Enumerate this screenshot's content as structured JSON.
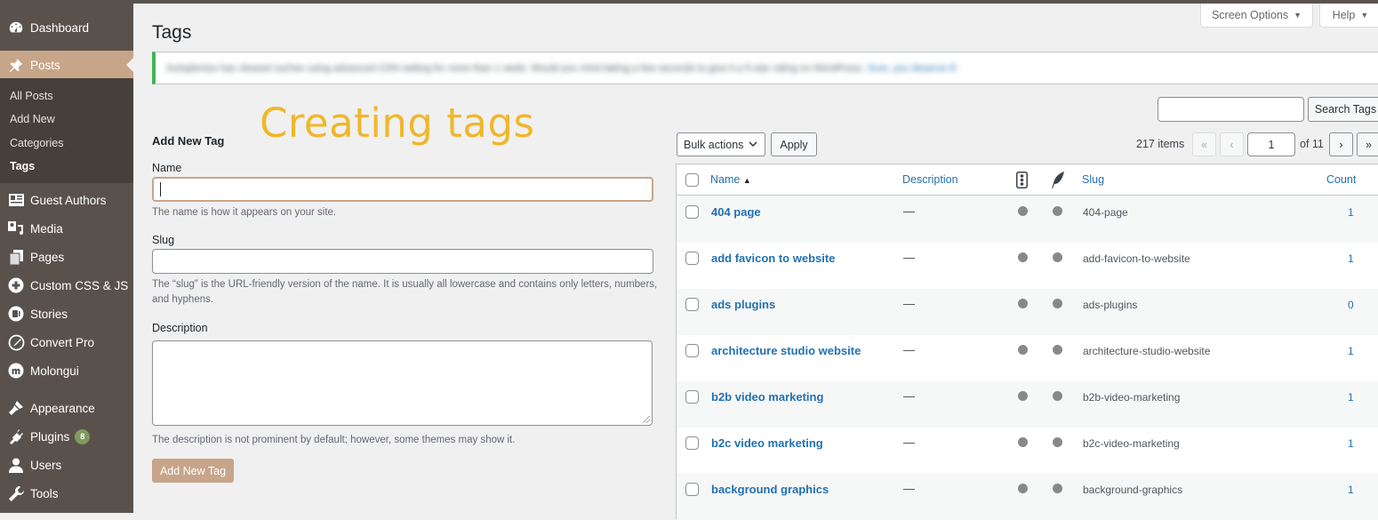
{
  "sidebar": {
    "items": [
      {
        "label": "Dashboard",
        "icon": "dashboard-icon"
      },
      {
        "label": "Posts",
        "icon": "pin-icon",
        "active": true
      },
      {
        "label": "Guest Authors",
        "icon": "id-card-icon"
      },
      {
        "label": "Media",
        "icon": "media-icon"
      },
      {
        "label": "Pages",
        "icon": "pages-icon"
      },
      {
        "label": "Custom CSS & JS",
        "icon": "plus-circle-icon"
      },
      {
        "label": "Stories",
        "icon": "stories-icon"
      },
      {
        "label": "Convert Pro",
        "icon": "compass-icon"
      },
      {
        "label": "Molongui",
        "icon": "molongui-icon"
      },
      {
        "label": "Appearance",
        "icon": "brush-icon"
      },
      {
        "label": "Plugins",
        "icon": "plug-icon",
        "badge": "8"
      },
      {
        "label": "Users",
        "icon": "user-icon"
      },
      {
        "label": "Tools",
        "icon": "wrench-icon"
      }
    ],
    "submenu": [
      {
        "label": "All Posts"
      },
      {
        "label": "Add New"
      },
      {
        "label": "Categories"
      },
      {
        "label": "Tags",
        "current": true
      }
    ]
  },
  "header": {
    "screen_options": "Screen Options",
    "help": "Help",
    "title": "Tags"
  },
  "notice": {
    "text": "Autoptimize has cleared caches using advanced CDN setting for more than 1 week. Would you mind taking a few seconds to give it a 5-star rating on WordPress.",
    "link": "Sure, you deserve it!"
  },
  "overlay": {
    "title": "Creating tags"
  },
  "form": {
    "heading": "Add New Tag",
    "name_label": "Name",
    "name_value": "",
    "name_help": "The name is how it appears on your site.",
    "slug_label": "Slug",
    "slug_value": "",
    "slug_help": "The “slug” is the URL-friendly version of the name. It is usually all lowercase and contains only letters, numbers, and hyphens.",
    "description_label": "Description",
    "description_value": "",
    "description_help": "The description is not prominent by default; however, some themes may show it.",
    "submit": "Add New Tag"
  },
  "list": {
    "search_value": "",
    "search_button": "Search Tags",
    "bulk_actions": "Bulk actions",
    "apply": "Apply",
    "items_count": "217 items",
    "first_page": "«",
    "prev_page": "‹",
    "current_page": "1",
    "of_pages": "of 11",
    "next_page": "›",
    "last_page": "»",
    "columns": {
      "name": "Name",
      "sort_indicator": "▲",
      "description": "Description",
      "slug": "Slug",
      "count": "Count"
    },
    "rows": [
      {
        "name": "404 page",
        "description": "—",
        "slug": "404-page",
        "count": "1"
      },
      {
        "name": "add favicon to website",
        "description": "—",
        "slug": "add-favicon-to-website",
        "count": "1"
      },
      {
        "name": "ads plugins",
        "description": "—",
        "slug": "ads-plugins",
        "count": "0"
      },
      {
        "name": "architecture studio website",
        "description": "—",
        "slug": "architecture-studio-website",
        "count": "1"
      },
      {
        "name": "b2b video marketing",
        "description": "—",
        "slug": "b2b-video-marketing",
        "count": "1"
      },
      {
        "name": "b2c video marketing",
        "description": "—",
        "slug": "b2c-video-marketing",
        "count": "1"
      },
      {
        "name": "background graphics",
        "description": "—",
        "slug": "background-graphics",
        "count": "1"
      }
    ]
  },
  "colors": {
    "sidebar_bg": "#59524c",
    "submenu_bg": "#46403c",
    "accent": "#c7a589",
    "link": "#2271b1",
    "notice_border": "#46b450",
    "overlay_title": "#f0b72a",
    "badge": "#7f9a5f"
  }
}
